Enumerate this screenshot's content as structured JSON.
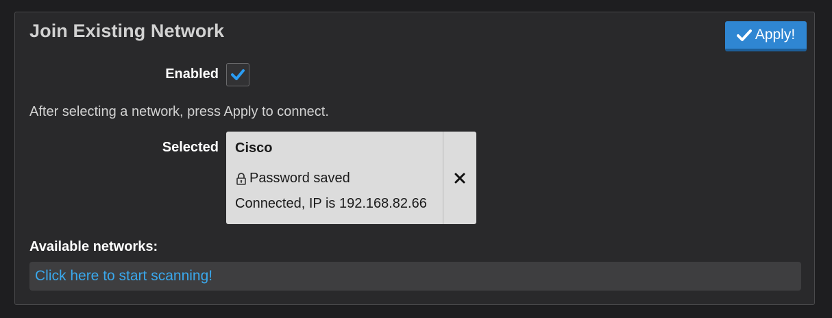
{
  "section": {
    "title": "Join Existing Network",
    "apply_label": "Apply!"
  },
  "enabled": {
    "label": "Enabled",
    "checked": true
  },
  "hint": "After selecting a network, press Apply to connect.",
  "selected": {
    "label": "Selected",
    "network_name": "Cisco",
    "password_status": "Password saved",
    "connection_status": "Connected, IP is 192.168.82.66",
    "remove_symbol": "✕"
  },
  "available": {
    "label": "Available networks:",
    "scan_link": "Click here to start scanning!"
  },
  "colors": {
    "accent": "#2f86d2",
    "link": "#3aa8ec",
    "check": "#2a9df4"
  },
  "icons": {
    "apply": "check-icon",
    "enabled": "checkmark-icon",
    "password": "lock-icon",
    "remove": "close-icon"
  }
}
